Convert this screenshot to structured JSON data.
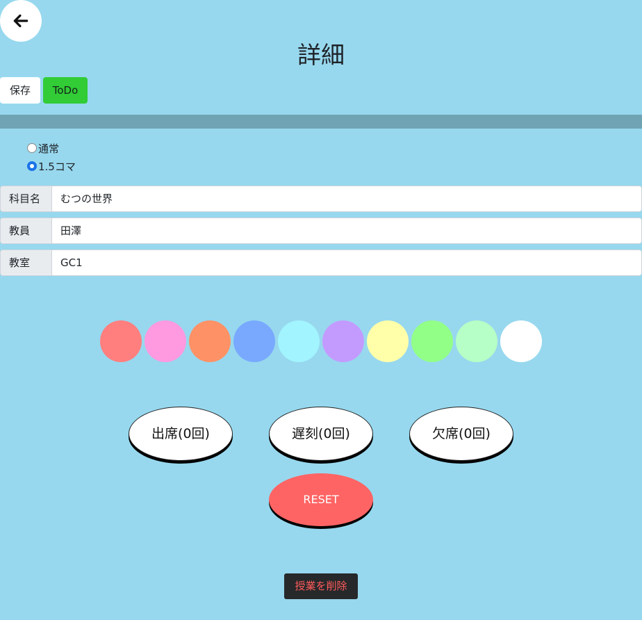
{
  "header": {
    "back_icon": "arrow-left-icon",
    "title": "詳細"
  },
  "toolbar": {
    "save_label": "保存",
    "todo_label": "ToDo"
  },
  "period_options": [
    {
      "label": "通常",
      "checked": false
    },
    {
      "label": "1.5コマ",
      "checked": true
    }
  ],
  "fields": {
    "subject": {
      "label": "科目名",
      "value": "むつの世界"
    },
    "teacher": {
      "label": "教員",
      "value": "田澤"
    },
    "room": {
      "label": "教室",
      "value": "GC1"
    }
  },
  "colors": [
    "#ff7f7f",
    "#ff99e0",
    "#ff9166",
    "#78a9ff",
    "#a2f4ff",
    "#c39bff",
    "#ffffaa",
    "#92ff87",
    "#b6ffc6",
    "#ffffff"
  ],
  "attendance": {
    "present_label": "出席(0回)",
    "late_label": "遅刻(0回)",
    "absent_label": "欠席(0回)"
  },
  "reset_label": "RESET",
  "delete_label": "授業を削除"
}
